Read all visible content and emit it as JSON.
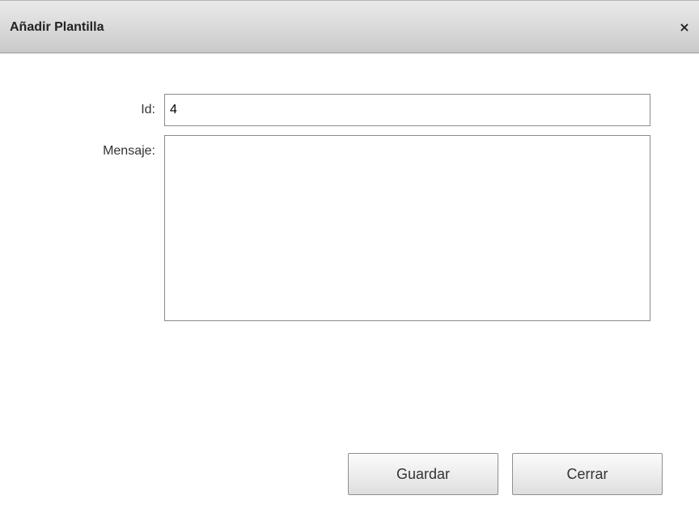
{
  "dialog": {
    "title": "Añadir Plantilla",
    "close_glyph": "×"
  },
  "form": {
    "id_label": "Id:",
    "id_value": "4",
    "message_label": "Mensaje:",
    "message_value": ""
  },
  "buttons": {
    "save_label": "Guardar",
    "close_label": "Cerrar"
  },
  "icons": {
    "close": "close-icon"
  }
}
